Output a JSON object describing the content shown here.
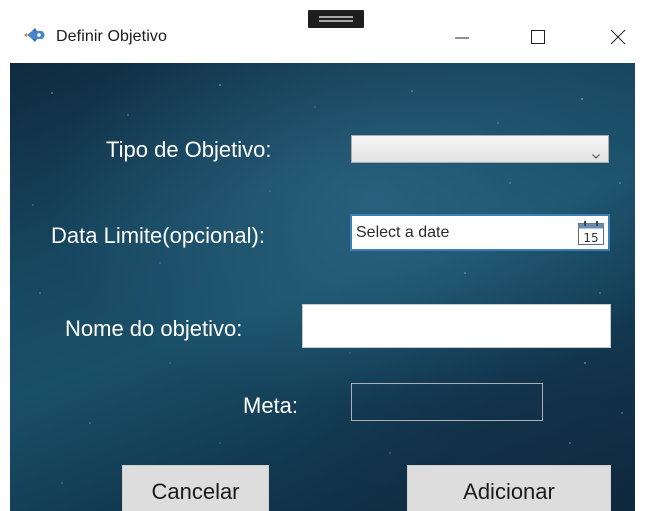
{
  "window": {
    "title": "Definir Objetivo",
    "app_icon": "rocket-icon",
    "caption_buttons": {
      "minimize": "minimize-icon",
      "maximize": "maximize-icon",
      "close": "close-icon"
    }
  },
  "form": {
    "tipo_label": "Tipo de Objetivo:",
    "tipo_value": "",
    "data_label": "Data Limite(opcional):",
    "data_placeholder": "Select a date",
    "calendar_day": "15",
    "nome_label": "Nome do objetivo:",
    "nome_value": "",
    "meta_label": "Meta:",
    "meta_value": ""
  },
  "buttons": {
    "cancel": "Cancelar",
    "add": "Adicionar"
  },
  "colors": {
    "background_dark": "#0f2a3f",
    "background_mid": "#1a4f68",
    "datepicker_border": "#3c7fb1",
    "button_face": "#dddddd"
  }
}
